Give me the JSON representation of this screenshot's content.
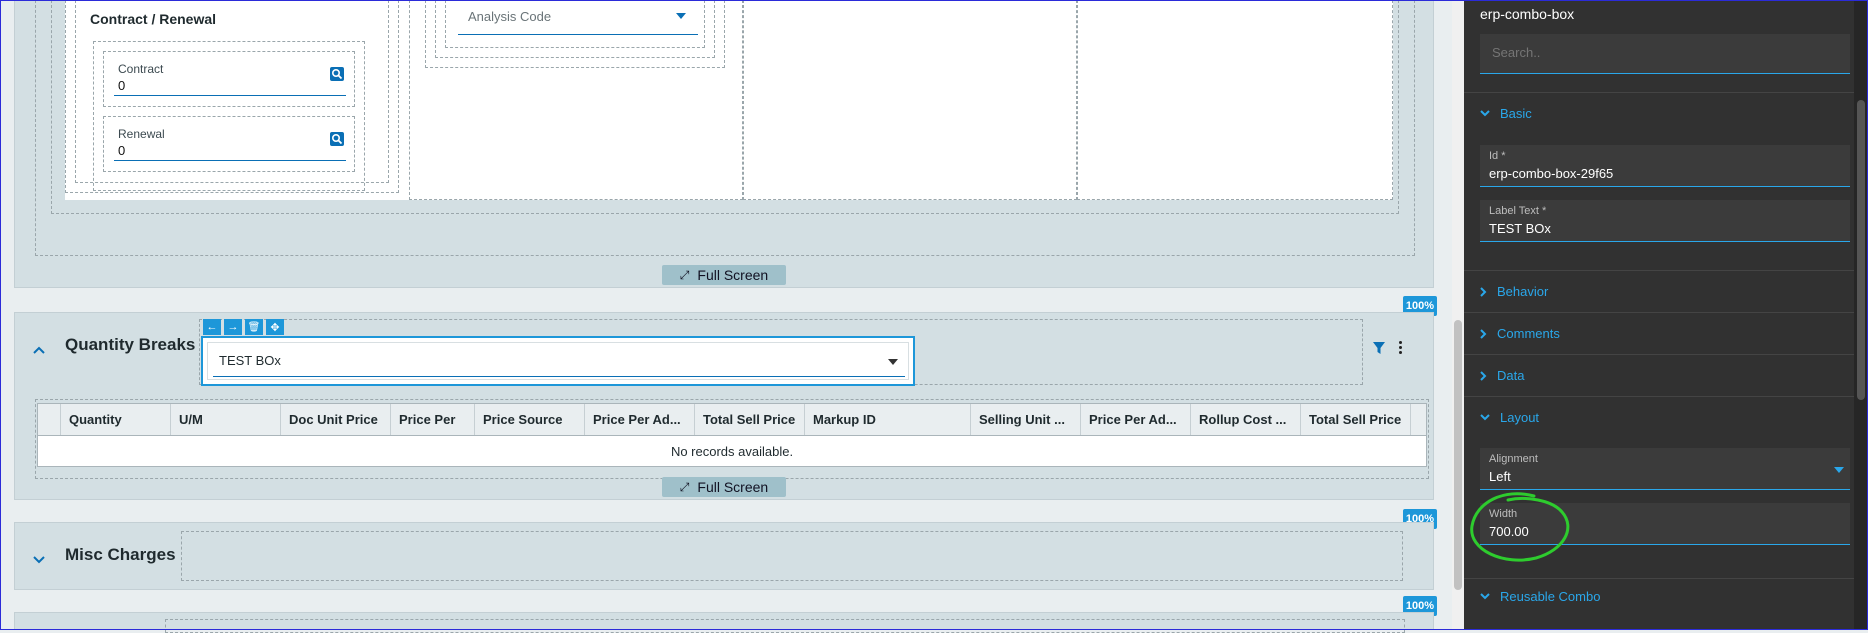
{
  "contract_renewal": {
    "title": "Contract / Renewal",
    "contract": {
      "label": "Contract",
      "value": "0"
    },
    "renewal": {
      "label": "Renewal",
      "value": "0"
    }
  },
  "analysis_code": {
    "placeholder": "Analysis Code"
  },
  "full_screen_label": "Full Screen",
  "zoom_label": "100%",
  "quantity_breaks": {
    "title": "Quantity Breaks",
    "combo": {
      "value": "TEST BOx"
    },
    "columns": [
      "Quantity",
      "U/M",
      "Doc Unit Price",
      "Price Per",
      "Price Source",
      "Price Per Ad...",
      "Total Sell Price",
      "Markup ID",
      "Selling Unit ...",
      "Price Per Ad...",
      "Rollup Cost ...",
      "Total Sell Price"
    ],
    "empty_message": "No records available."
  },
  "misc_charges": {
    "title": "Misc Charges"
  },
  "properties_panel": {
    "component_name": "erp-combo-box",
    "search_placeholder": "Search..",
    "sections": {
      "basic": "Basic",
      "behavior": "Behavior",
      "comments": "Comments",
      "data": "Data",
      "layout": "Layout",
      "reusable_combo": "Reusable Combo"
    },
    "id_field": {
      "label": "Id *",
      "value": "erp-combo-box-29f65"
    },
    "label_text_field": {
      "label": "Label Text *",
      "value": "TEST BOx"
    },
    "alignment_field": {
      "label": "Alignment",
      "value": "Left"
    },
    "width_field": {
      "label": "Width",
      "value": "700.00"
    }
  },
  "colors": {
    "accent": "#2aa7ea",
    "highlight_circle": "#2ecc2e",
    "panel_bg": "#313131"
  }
}
